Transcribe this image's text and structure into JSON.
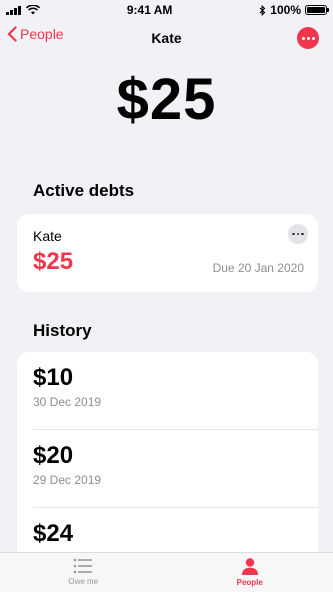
{
  "status_bar": {
    "time": "9:41 AM",
    "battery_text": "100%",
    "battery_level": 1.0
  },
  "nav": {
    "back_label": "People",
    "title": "Kate"
  },
  "total_amount": "$25",
  "active_debts": {
    "title": "Active debts",
    "items": [
      {
        "name": "Kate",
        "amount": "$25",
        "due": "Due 20 Jan 2020"
      }
    ]
  },
  "history": {
    "title": "History",
    "items": [
      {
        "amount": "$10",
        "date": "30 Dec 2019"
      },
      {
        "amount": "$20",
        "date": "29 Dec 2019"
      },
      {
        "amount": "$24",
        "date": ""
      }
    ]
  },
  "tabs": [
    {
      "label": "Owe me",
      "icon": "list-icon",
      "active": false
    },
    {
      "label": "People",
      "icon": "person-icon",
      "active": true
    }
  ],
  "colors": {
    "accent": "#f0364c",
    "background": "#f2f1f6",
    "secondary_text": "#8e8e93"
  }
}
